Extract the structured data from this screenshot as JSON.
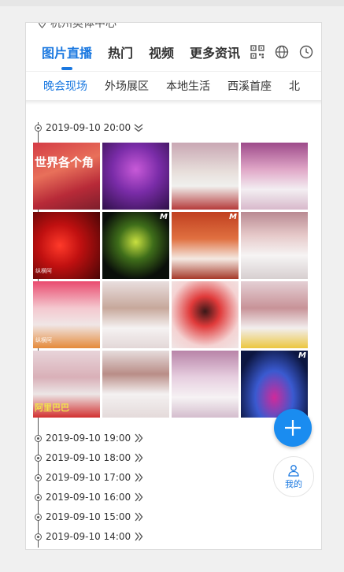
{
  "location": {
    "text": "杭州奥体中心"
  },
  "tabs": [
    {
      "label": "图片直播",
      "active": true
    },
    {
      "label": "热门"
    },
    {
      "label": "视频"
    },
    {
      "label": "更多资讯"
    }
  ],
  "tab_icons": [
    "qr-code-icon",
    "globe-icon",
    "clock-icon"
  ],
  "subtabs": [
    {
      "label": "晚会现场",
      "active": true
    },
    {
      "label": "外场展区"
    },
    {
      "label": "本地生活"
    },
    {
      "label": "西溪首座"
    },
    {
      "label": "北"
    }
  ],
  "timeline": {
    "expanded": {
      "time": "2019-09-10 20:00"
    },
    "collapsed": [
      {
        "time": "2019-09-10 19:00"
      },
      {
        "time": "2019-09-10 18:00"
      },
      {
        "time": "2019-09-10 17:00"
      },
      {
        "time": "2019-09-10 16:00"
      },
      {
        "time": "2019-09-10 15:00"
      },
      {
        "time": "2019-09-10 14:00"
      }
    ]
  },
  "photos": {
    "watermark": "纵横阿",
    "overlay_text_1": "世界各个角",
    "overlay_text_16": "阿里巴巴"
  },
  "fab": {
    "icon": "plus-icon",
    "color": "#1a8cf0"
  },
  "mine": {
    "label": "我的",
    "icon": "user-icon"
  },
  "colors": {
    "accent": "#1a78e0"
  }
}
